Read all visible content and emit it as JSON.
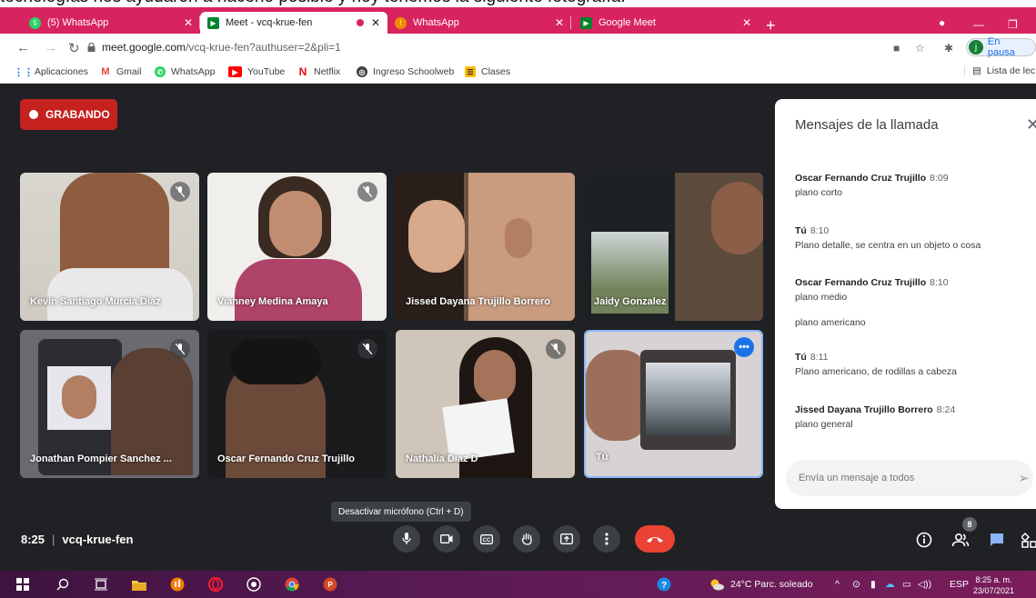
{
  "caption": "tecnologías nos ayudaron a hacerlo posible y hoy tenemos la siguiente fotografía:",
  "tabs": [
    {
      "label": "(5) WhatsApp",
      "active": false
    },
    {
      "label": "Meet - vcq-krue-fen",
      "active": true
    },
    {
      "label": "WhatsApp",
      "active": false
    },
    {
      "label": "Google Meet",
      "active": false
    }
  ],
  "address": {
    "domain": "meet.google.com",
    "path": "/vcq-krue-fen?authuser=2&pli=1"
  },
  "profile": {
    "initial": "j",
    "status": "En pausa"
  },
  "bookmarks": [
    "Aplicaciones",
    "Gmail",
    "WhatsApp",
    "YouTube",
    "Netflix",
    "Ingreso Schoolweb",
    "Clases"
  ],
  "reading_list": "Lista de lec",
  "recording": "GRABANDO",
  "participants": [
    {
      "name": "Kevin Santiago Murcia Diaz"
    },
    {
      "name": "Vianney Medina Amaya"
    },
    {
      "name": "Jissed Dayana Trujillo Borrero"
    },
    {
      "name": "Jaidy Gonzalez"
    },
    {
      "name": "Jonathan Pompier Sanchez ..."
    },
    {
      "name": "Oscar Fernando Cruz Trujillo"
    },
    {
      "name": "Nathalia Diaz D"
    },
    {
      "name": "Tú"
    }
  ],
  "chat": {
    "title": "Mensajes de la llamada",
    "messages": [
      {
        "sender": "Oscar Fernando Cruz Trujillo",
        "time": "8:09",
        "lines": [
          "plano corto"
        ]
      },
      {
        "sender": "Tú",
        "time": "8:10",
        "lines": [
          "Plano detalle, se centra en un objeto o cosa"
        ]
      },
      {
        "sender": "Oscar Fernando Cruz Trujillo",
        "time": "8:10",
        "lines": [
          "plano medio",
          "plano americano"
        ]
      },
      {
        "sender": "Tú",
        "time": "8:11",
        "lines": [
          "Plano americano, de rodillas a cabeza"
        ]
      },
      {
        "sender": "Jissed Dayana Trujillo Borrero",
        "time": "8:24",
        "lines": [
          "plano general"
        ]
      }
    ],
    "input_placeholder": "Envía un mensaje a todos"
  },
  "tooltip": "Desactivar micrófono (Ctrl + D)",
  "meeting": {
    "time": "8:25",
    "code": "vcq-krue-fen"
  },
  "people_count": "8",
  "taskbar": {
    "weather": "24°C  Parc. soleado",
    "lang": "ESP",
    "clock_time": "8:25 a. m.",
    "clock_date": "23/07/2021"
  }
}
